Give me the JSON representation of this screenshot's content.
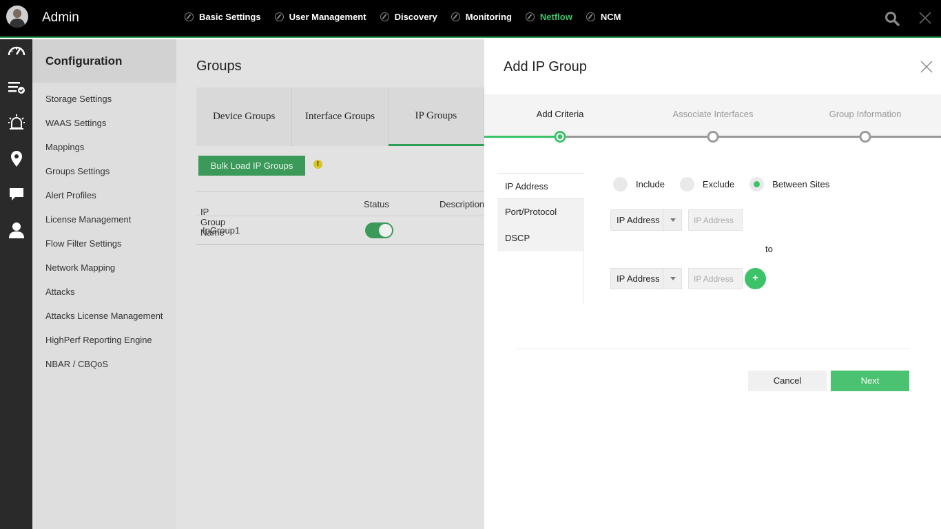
{
  "header": {
    "app_title": "Admin",
    "nav": [
      {
        "label": "Basic Settings",
        "icon": "slash-circle-icon",
        "active": false
      },
      {
        "label": "User Management",
        "icon": "slash-circle-icon",
        "active": false
      },
      {
        "label": "Discovery",
        "icon": "slash-circle-icon",
        "active": false
      },
      {
        "label": "Monitoring",
        "icon": "slash-circle-icon",
        "active": false
      },
      {
        "label": "Netflow",
        "icon": "slash-circle-icon",
        "active": true
      },
      {
        "label": "NCM",
        "icon": "slash-circle-icon",
        "active": false
      }
    ],
    "accent_color": "#3cc36a"
  },
  "rail": {
    "icons": [
      "dashboard-icon",
      "inventory-icon",
      "alarm-icon",
      "map-pin-icon",
      "chat-icon",
      "user-icon"
    ]
  },
  "sidebar": {
    "title": "Configuration",
    "items": [
      "Storage Settings",
      "WAAS Settings",
      "Mappings",
      "Groups Settings",
      "Alert Profiles",
      "License Management",
      "Flow Filter Settings",
      "Network Mapping",
      "Attacks",
      "Attacks License Management",
      "HighPerf Reporting Engine",
      "NBAR / CBQoS"
    ]
  },
  "main": {
    "title": "Groups",
    "tabs": [
      "Device Groups",
      "Interface Groups",
      "IP Groups"
    ],
    "active_tab": "IP Groups",
    "bulk_button": "Bulk Load IP Groups",
    "warning_glyph": "!",
    "columns": [
      "IP Group Name",
      "Status",
      "Description"
    ],
    "rows": [
      {
        "name": "IpGroup1",
        "status_on": true
      }
    ]
  },
  "dialog": {
    "title": "Add IP Group",
    "steps": [
      "Add Criteria",
      "Associate Interfaces",
      "Group Information"
    ],
    "active_step": 0,
    "criteria_tabs": [
      "IP Address",
      "Port/Protocol",
      "DSCP"
    ],
    "active_criteria": "IP Address",
    "radios": [
      {
        "label": "Include",
        "checked": false
      },
      {
        "label": "Exclude",
        "checked": false
      },
      {
        "label": "Between Sites",
        "checked": true
      }
    ],
    "select_value": "IP Address",
    "input_placeholder": "IP Address",
    "to_label": "to",
    "plus_label": "+",
    "cancel_label": "Cancel",
    "next_label": "Next"
  }
}
